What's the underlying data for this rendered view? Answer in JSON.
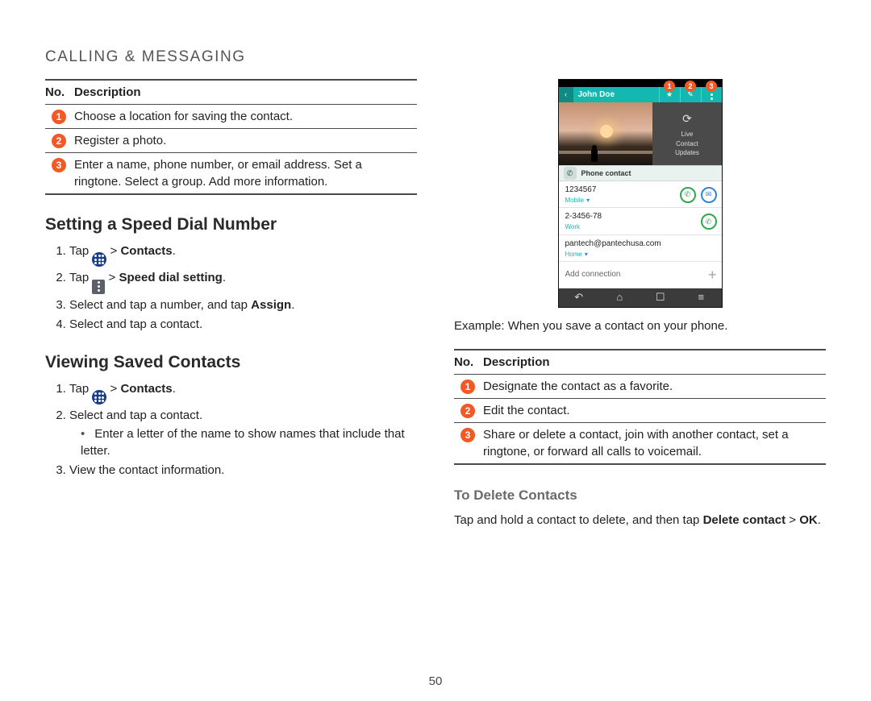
{
  "header": {
    "title": "CALLING & MESSAGING"
  },
  "page_number": "50",
  "table_header": {
    "no": "No.",
    "desc": "Description"
  },
  "left": {
    "table": {
      "rows": [
        {
          "n": "1",
          "desc": "Choose a location for saving the contact."
        },
        {
          "n": "2",
          "desc": "Register a photo."
        },
        {
          "n": "3",
          "desc": "Enter a name, phone number, or email address. Set a ringtone. Select a group. Add more information."
        }
      ]
    },
    "h_speed": "Setting a Speed Dial Number",
    "steps_speed": {
      "s1_tap": "Tap ",
      "s1_after": " > ",
      "s1_bold": "Contacts",
      "s1_end": ".",
      "s2_tap": "Tap ",
      "s2_after": " > ",
      "s2_bold": "Speed dial setting",
      "s2_end": ".",
      "s3_a": "Select and tap a number, and tap ",
      "s3_bold": "Assign",
      "s3_end": ".",
      "s4": "Select and tap a contact."
    },
    "h_view": "Viewing Saved Contacts",
    "steps_view": {
      "s1_tap": "Tap ",
      "s1_after": " > ",
      "s1_bold": "Contacts",
      "s1_end": ".",
      "s2": "Select and tap a contact.",
      "s2_sub": "Enter a letter of the name to show names that include that letter.",
      "s3": "View the contact information."
    }
  },
  "right": {
    "phone": {
      "contact_name": "John Doe",
      "header_buttons": {
        "b1": "1",
        "b2": "2",
        "b3": "3"
      },
      "updates_line1": "Live",
      "updates_line2": "Contact",
      "updates_line3": "Updates",
      "section_label": "Phone contact",
      "rows": [
        {
          "value": "1234567",
          "label": "Mobile",
          "call": true,
          "msg": true
        },
        {
          "value": "2-3456-78",
          "label": "Work",
          "call": true,
          "msg": false
        },
        {
          "value": "pantech@pantechusa.com",
          "label": "Home",
          "call": false,
          "msg": false
        }
      ],
      "add_connection": "Add connection"
    },
    "caption": "Example: When you save a contact on your phone.",
    "table": {
      "rows": [
        {
          "n": "1",
          "desc": "Designate the contact as a favorite."
        },
        {
          "n": "2",
          "desc": "Edit the contact."
        },
        {
          "n": "3",
          "desc": "Share or delete a contact, join with another contact, set a ringtone, or forward all calls to voicemail."
        }
      ]
    },
    "h_delete": "To Delete Contacts",
    "delete_para": {
      "a": "Tap and hold a contact to delete, and then tap ",
      "b1": "Delete contact",
      "c": " > ",
      "b2": "OK",
      "d": "."
    }
  }
}
